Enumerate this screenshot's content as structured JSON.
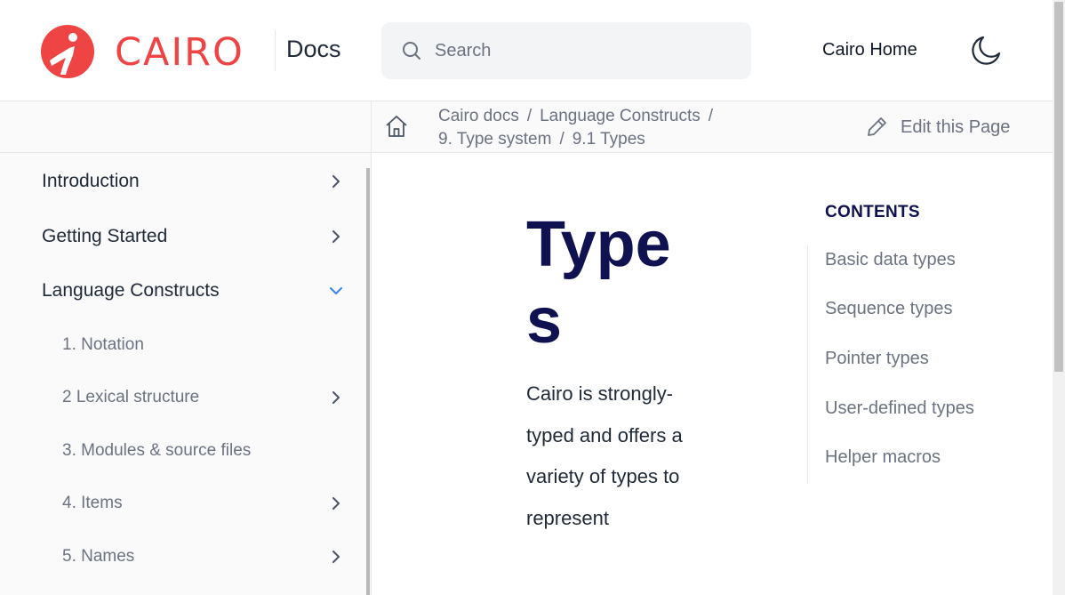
{
  "header": {
    "logo_text": "CAIRO",
    "docs_label": "Docs",
    "search_placeholder": "Search",
    "home_link": "Cairo Home",
    "brand_color": "#ef4444"
  },
  "breadcrumb": {
    "items": [
      "Cairo docs",
      "Language Constructs",
      "9. Type system",
      "9.1 Types"
    ],
    "separator": "/",
    "edit_label": "Edit this Page"
  },
  "sidebar": {
    "items": [
      {
        "label": "Introduction",
        "icon": "chevron-right-icon"
      },
      {
        "label": "Getting Started",
        "icon": "chevron-right-icon"
      },
      {
        "label": "Language Constructs",
        "icon": "chevron-down-icon"
      }
    ],
    "sub_items": [
      {
        "label": "1. Notation"
      },
      {
        "label": "2 Lexical structure",
        "icon": "chevron-right-icon"
      },
      {
        "label": "3. Modules & source files"
      },
      {
        "label": "4. Items",
        "icon": "chevron-right-icon"
      },
      {
        "label": "5. Names",
        "icon": "chevron-right-icon"
      }
    ]
  },
  "main": {
    "title": "Types",
    "intro": "Cairo is strongly-typed and offers a variety of types to represent"
  },
  "toc": {
    "title": "CONTENTS",
    "items": [
      "Basic data types",
      "Sequence types",
      "Pointer types",
      "User-defined types",
      "Helper macros"
    ]
  }
}
